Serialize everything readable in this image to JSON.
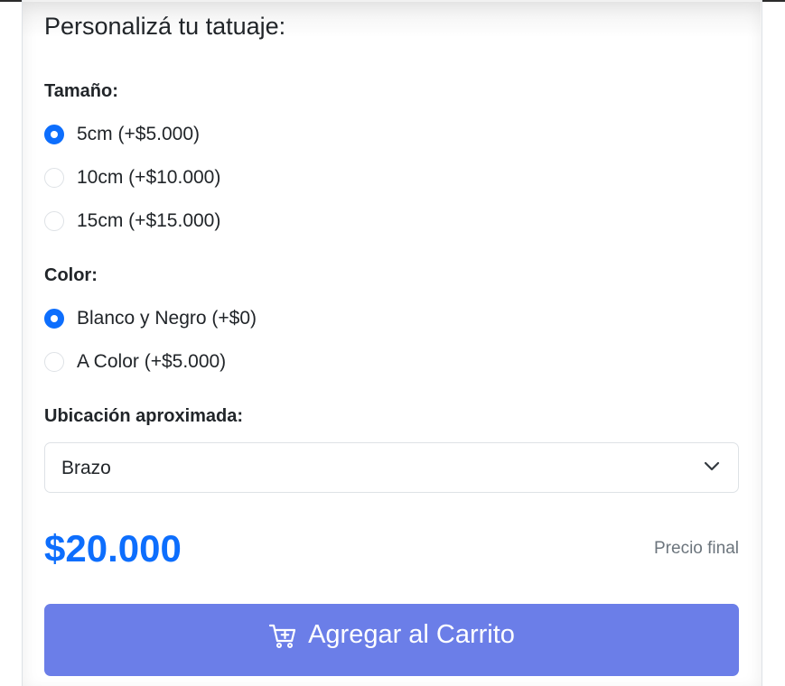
{
  "form": {
    "title": "Personalizá tu tatuaje:",
    "size": {
      "label": "Tamaño:",
      "options": [
        {
          "label": "5cm (+$5.000)",
          "checked": true
        },
        {
          "label": "10cm (+$10.000)",
          "checked": false
        },
        {
          "label": "15cm (+$15.000)",
          "checked": false
        }
      ]
    },
    "color": {
      "label": "Color:",
      "options": [
        {
          "label": "Blanco y Negro (+$0)",
          "checked": true
        },
        {
          "label": "A Color (+$5.000)",
          "checked": false
        }
      ]
    },
    "location": {
      "label": "Ubicación aproximada:",
      "selected": "Brazo",
      "icon": "chevron-down-icon"
    },
    "price": {
      "value": "$20.000",
      "caption": "Precio final"
    },
    "cart_button": {
      "label": "Agregar al Carrito",
      "icon": "cart-plus-icon"
    }
  },
  "colors": {
    "accent": "#0d6efd",
    "button": "#6b7ee8",
    "muted": "#6c757d"
  }
}
